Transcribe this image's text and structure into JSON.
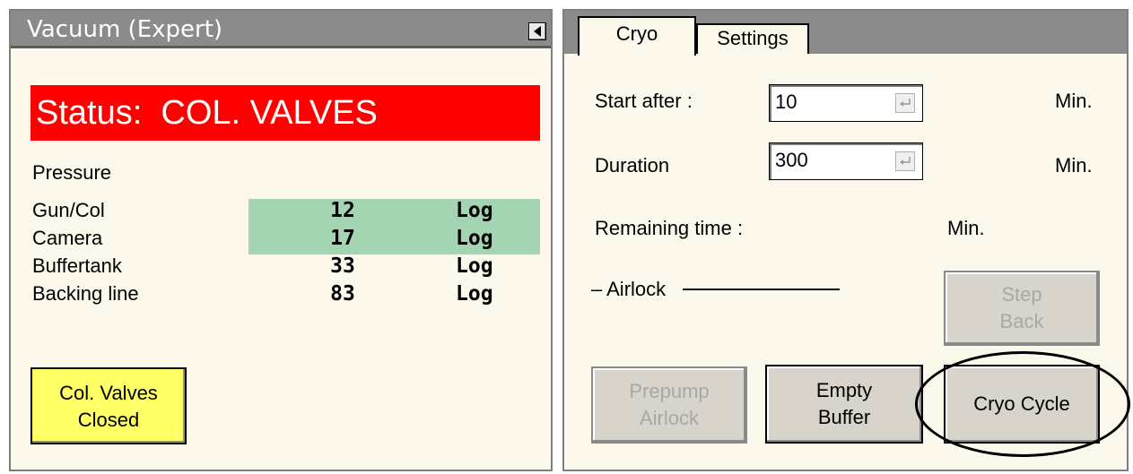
{
  "vacuum_panel": {
    "title": "Vacuum (Expert)",
    "collapse_icon": "triangle-left-icon",
    "status": {
      "prefix": "Status:",
      "value": "COL. VALVES",
      "color": "#ff0000"
    },
    "pressure_label": "Pressure",
    "pressure_rows": [
      {
        "name": "Gun/Col",
        "value": "12",
        "unit": "Log",
        "highlighted": true
      },
      {
        "name": "Camera",
        "value": "17",
        "unit": "Log",
        "highlighted": true
      },
      {
        "name": "Buffertank",
        "value": "33",
        "unit": "Log",
        "highlighted": false
      },
      {
        "name": "Backing line",
        "value": "83",
        "unit": "Log",
        "highlighted": false
      }
    ],
    "highlight_color": "#a3d5b2",
    "col_valves_button": {
      "line1": "Col. Valves",
      "line2": "Closed",
      "color": "#ffff66"
    }
  },
  "cryo_panel": {
    "tabs": [
      {
        "label": "Cryo",
        "active": true
      },
      {
        "label": "Settings",
        "active": false
      }
    ],
    "start_after": {
      "label": "Start after :",
      "value": "10",
      "unit": "Min."
    },
    "duration": {
      "label": "Duration",
      "value": "300",
      "unit": "Min."
    },
    "remaining_time": {
      "label": "Remaining time :",
      "unit": "Min."
    },
    "airlock_label": "– Airlock",
    "buttons": {
      "step_back": {
        "line1": "Step",
        "line2": "Back",
        "enabled": false
      },
      "prepump_airlock": {
        "line1": "Prepump",
        "line2": "Airlock",
        "enabled": false
      },
      "empty_buffer": {
        "line1": "Empty",
        "line2": "Buffer",
        "enabled": true
      },
      "cryo_cycle": {
        "label": "Cryo Cycle",
        "enabled": true
      }
    },
    "enter_icon": "enter-return-icon"
  }
}
